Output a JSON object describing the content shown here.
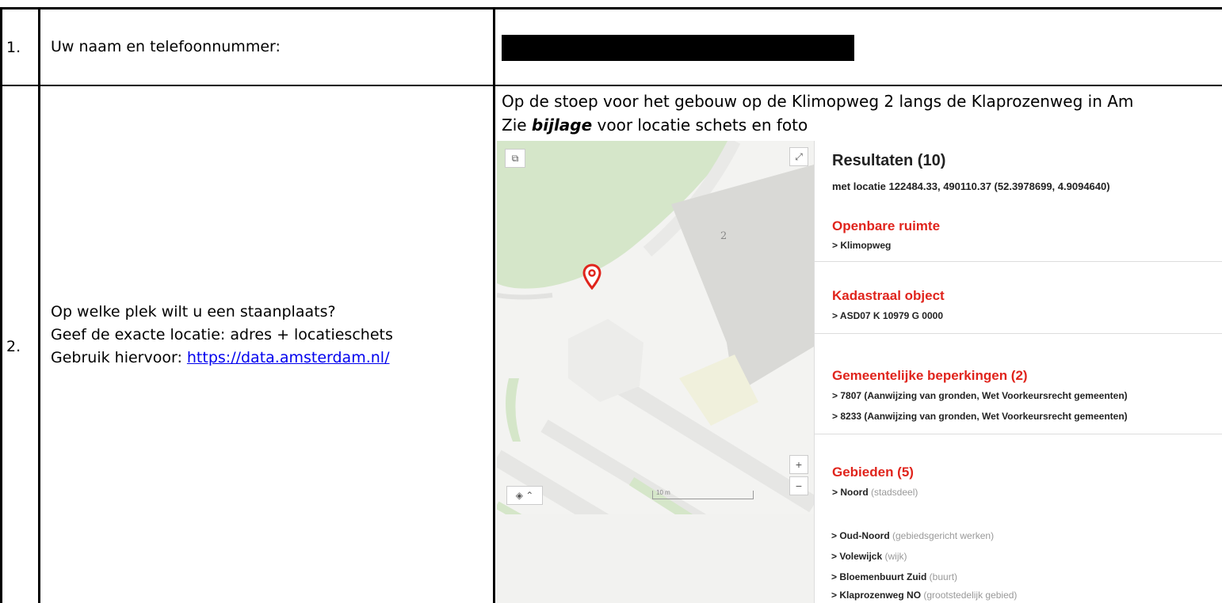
{
  "rows": [
    {
      "number": "1.",
      "question": "Uw naam en telefoonnummer:"
    },
    {
      "number": "2.",
      "question_lines": [
        "Op welke plek wilt u een staanplaats?",
        "Geef de exacte locatie: adres + locatieschets"
      ],
      "link_prefix": "Gebruik hiervoor: ",
      "link_text": "https://data.amsterdam.nl/"
    }
  ],
  "answer": {
    "line1": "Op de stoep voor het gebouw op de Klimopweg 2 langs de Klaprozenweg in Am",
    "line2_prefix": "Zie ",
    "line2_bold": "bijlage",
    "line2_suffix": " voor locatie schets en foto"
  },
  "results": {
    "title": "Resultaten (10)",
    "subtitle": "met locatie 122484.33, 490110.37 (52.3978699, 4.9094640)",
    "sections": [
      {
        "title": "Openbare ruimte",
        "items": [
          {
            "name": "Klimopweg",
            "note": ""
          }
        ]
      },
      {
        "title": "Kadastraal object",
        "items": [
          {
            "name": "ASD07 K 10979 G 0000",
            "note": ""
          }
        ]
      },
      {
        "title": "Gemeentelijke beperkingen (2)",
        "items": [
          {
            "name": "7807 (Aanwijzing van gronden, Wet Voorkeursrecht gemeenten)",
            "note": ""
          },
          {
            "name": "8233 (Aanwijzing van gronden, Wet Voorkeursrecht gemeenten)",
            "note": ""
          }
        ]
      },
      {
        "title": "Gebieden (5)",
        "items": [
          {
            "name": "Noord",
            "note": " (stadsdeel)"
          },
          {
            "name": "Oud-Noord",
            "note": " (gebiedsgericht werken)"
          },
          {
            "name": "Volewijck",
            "note": " (wijk)"
          },
          {
            "name": "Bloemenbuurt Zuid",
            "note": " (buurt)"
          },
          {
            "name": "Klaprozenweg NO",
            "note": " (grootstedelijk gebied)"
          }
        ]
      }
    ]
  },
  "map": {
    "building_number": "2",
    "scale_label": "10 m",
    "zoom_in": "+",
    "zoom_out": "−"
  },
  "colors": {
    "accent": "#e0241c",
    "green": "#d5e6c9",
    "building": "#d9d9d6",
    "road": "#e6e6e4"
  }
}
